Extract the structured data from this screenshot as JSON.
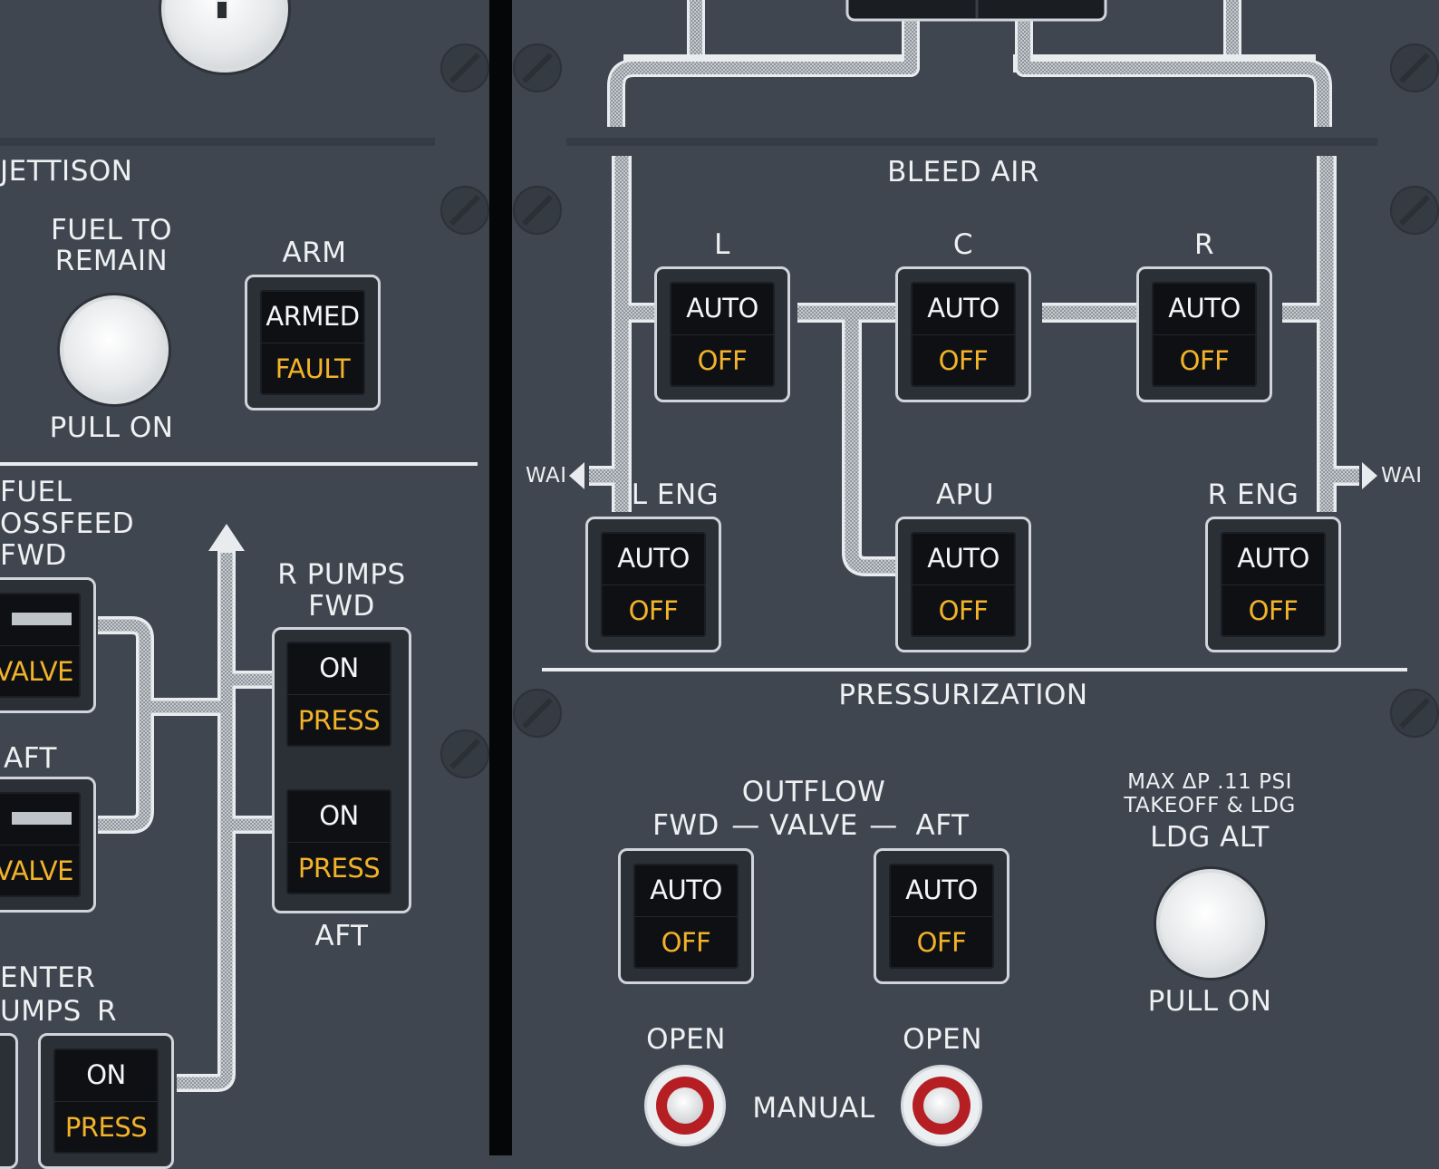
{
  "left": {
    "jettison_title": "JETTISON",
    "fuel_to_remain": [
      "FUEL TO",
      "REMAIN"
    ],
    "fuel_to_remain_pull": "PULL ON",
    "arm_label": "ARM",
    "arm_button": {
      "top": "ARMED",
      "bottom": "FAULT"
    },
    "crossfeed_title": [
      "FUEL",
      "OSSFEED",
      "FWD"
    ],
    "crossfeed_fwd_valve": "VALVE",
    "crossfeed_aft_label": "AFT",
    "crossfeed_aft_valve": "VALVE",
    "r_pumps_title": [
      "R PUMPS",
      "FWD"
    ],
    "r_pump_fwd": {
      "top": "ON",
      "bottom": "PRESS"
    },
    "r_pump_aft": {
      "top": "ON",
      "bottom": "PRESS"
    },
    "r_pumps_aft_label": "AFT",
    "center_pumps_title": [
      "ENTER",
      "UMPS"
    ],
    "center_pumps_r": "R",
    "center_pump_r": {
      "top": "ON",
      "bottom": "PRESS"
    }
  },
  "bleed": {
    "title": "BLEED AIR",
    "l_label": "L",
    "c_label": "C",
    "r_label": "R",
    "l_isln": {
      "top": "AUTO",
      "bottom": "OFF"
    },
    "c_isln": {
      "top": "AUTO",
      "bottom": "OFF"
    },
    "r_isln": {
      "top": "AUTO",
      "bottom": "OFF"
    },
    "wai_left": "WAI",
    "wai_right": "WAI",
    "l_eng_label": "L ENG",
    "apu_label": "APU",
    "r_eng_label": "R ENG",
    "l_eng": {
      "top": "AUTO",
      "bottom": "OFF"
    },
    "apu": {
      "top": "AUTO",
      "bottom": "OFF"
    },
    "r_eng": {
      "top": "AUTO",
      "bottom": "OFF"
    }
  },
  "press": {
    "title": "PRESSURIZATION",
    "outflow_title": "OUTFLOW",
    "fwd": "FWD",
    "valve": "VALVE",
    "aft": "AFT",
    "dash": "—",
    "fwd_valve": {
      "top": "AUTO",
      "bottom": "OFF"
    },
    "aft_valve": {
      "top": "AUTO",
      "bottom": "OFF"
    },
    "max_dp": "MAX ΔP .11 PSI",
    "takeoff_ldg": "TAKEOFF & LDG",
    "ldg_alt": "LDG ALT",
    "ldg_alt_pull": "PULL ON",
    "open_fwd": "OPEN",
    "open_aft": "OPEN",
    "manual": "MANUAL"
  },
  "colors": {
    "panel": "#3f4650",
    "amber": "#f2b32a",
    "legend_white": "#f5f6f7",
    "manual_red": "#b51f24"
  }
}
